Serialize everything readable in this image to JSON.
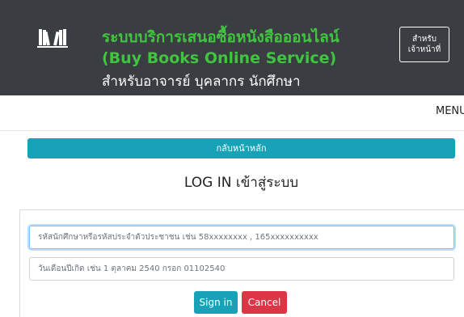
{
  "header": {
    "title_th": "ระบบบริการเสนอซื้อหนังสือออนไลน์",
    "title_en": "(Buy Books Online Service)",
    "subtitle": "สำหรับอาจารย์ บุคลากร นักศึกษา",
    "staff_button_line1": "สำหรับ",
    "staff_button_line2": "เจ้าหน้าที่",
    "logo_icon": "books-icon",
    "background_color": "#3a3e42",
    "title_color": "#41c43f"
  },
  "menu": {
    "label": "MENU"
  },
  "home_button": {
    "label": "กลับหน้าหลัก",
    "color": "#17a2b8"
  },
  "login": {
    "heading": "LOG IN เข้าสู่ระบบ",
    "id_field": {
      "value": "",
      "placeholder": "รหัสนักศึกษาหรือรหัสประจำตัวประชาชน เช่น 58xxxxxxxx , 165xxxxxxxxxx"
    },
    "dob_field": {
      "value": "",
      "placeholder": "วันเดือนปีเกิด เช่น 1 ตุลาคม 2540 กรอก 01102540"
    },
    "sign_in_label": "Sign in",
    "cancel_label": "Cancel",
    "sign_in_color": "#17a2b8",
    "cancel_color": "#dc3545"
  }
}
